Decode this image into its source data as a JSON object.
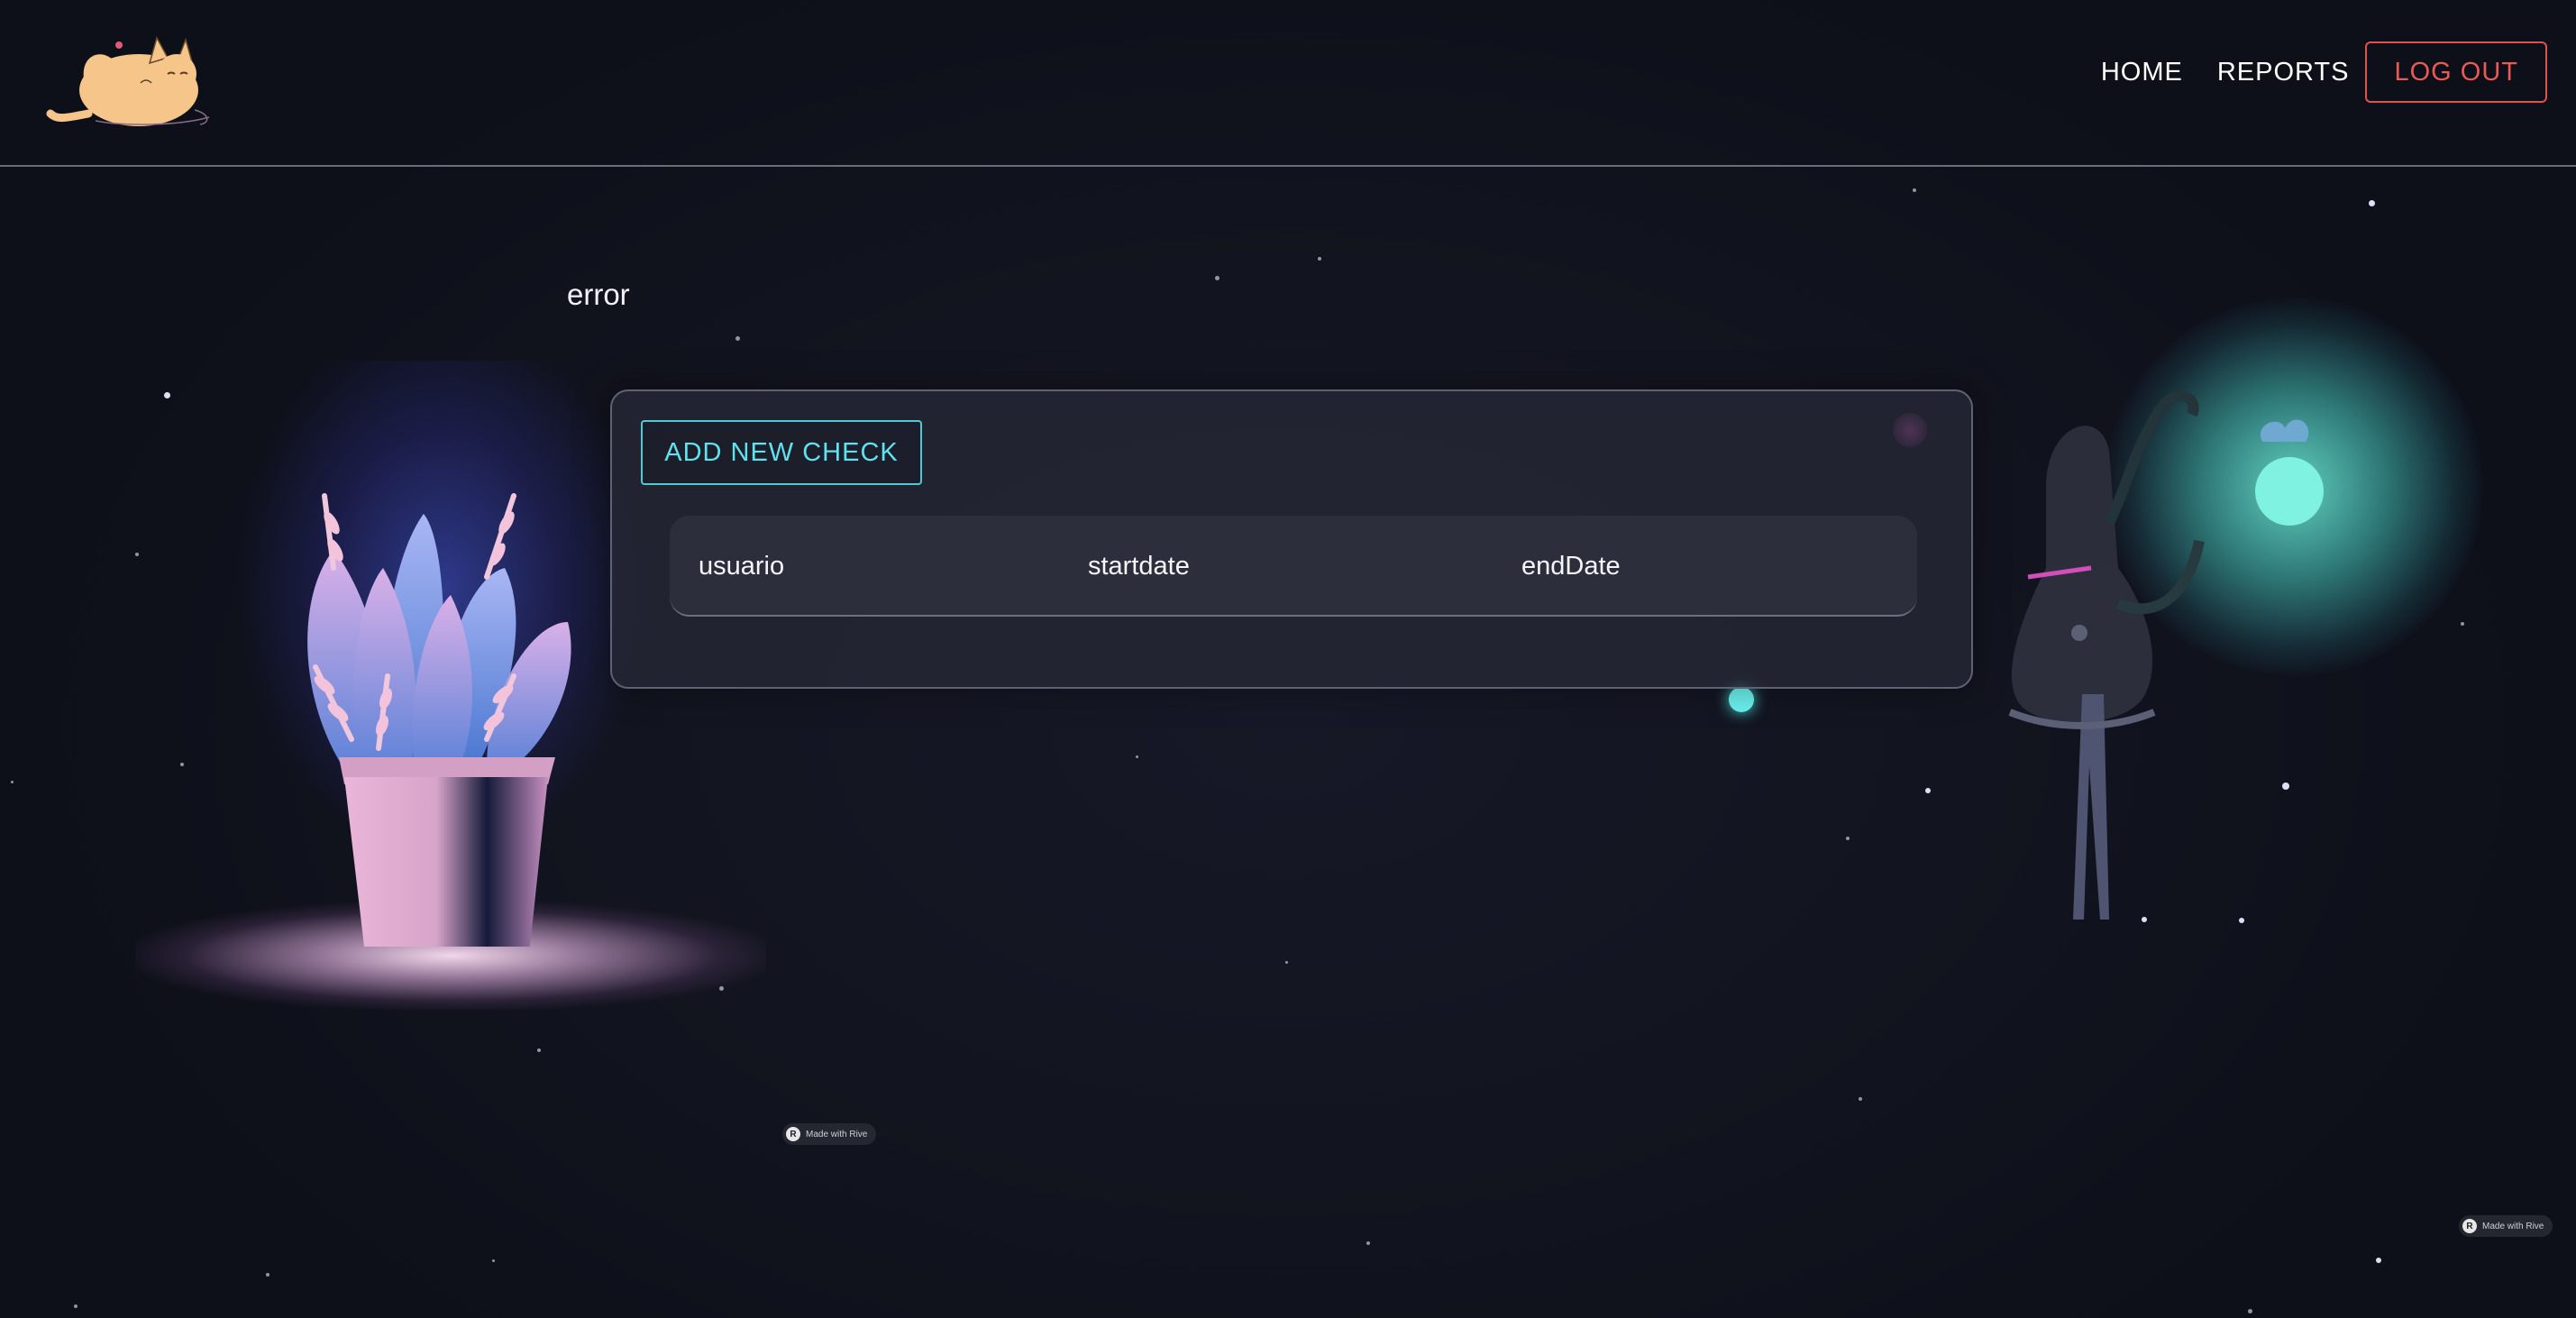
{
  "header": {
    "logo_alt": "cat logo",
    "nav": {
      "home_label": "HOME",
      "reports_label": "REPORTS",
      "logout_label": "LOG OUT"
    }
  },
  "main": {
    "error_text": "error",
    "add_button_label": "ADD NEW CHECK",
    "table": {
      "columns": [
        "usuario",
        "startdate",
        "endDate"
      ],
      "rows": []
    }
  },
  "badges": {
    "rive_label": "Made with Rive"
  },
  "colors": {
    "accent_cyan": "#5fe1ee",
    "logout_red": "#ea5a55",
    "background": "#11131f"
  },
  "icons": {
    "logo": "cat-icon",
    "rive_badge": "rive-logo-icon"
  }
}
